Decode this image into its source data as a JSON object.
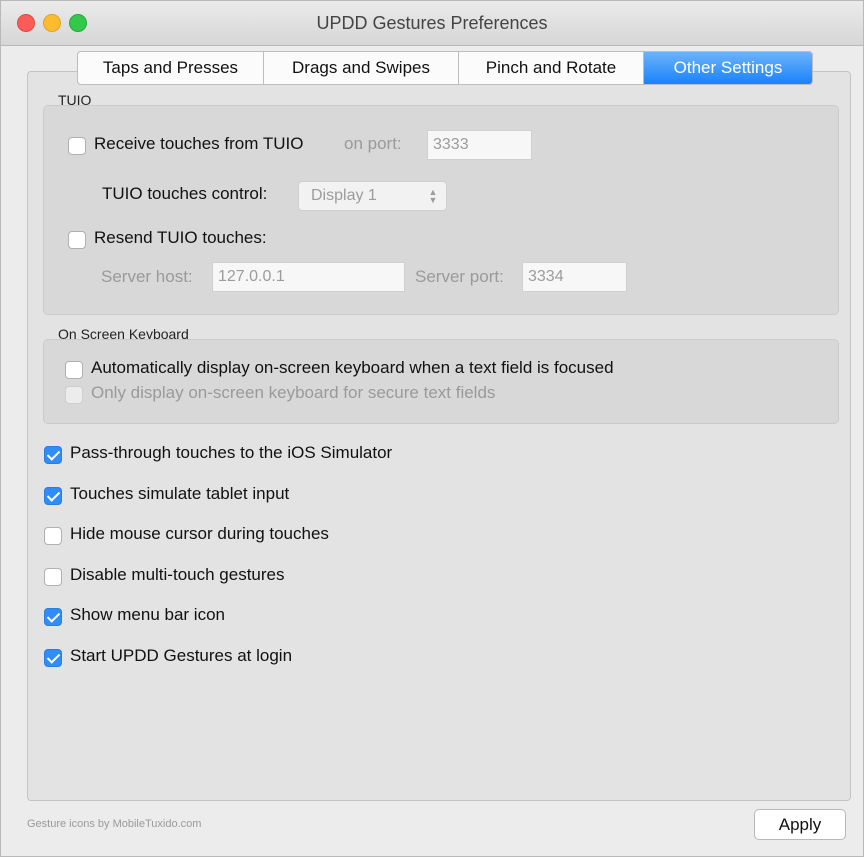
{
  "window": {
    "title": "UPDD Gestures Preferences"
  },
  "tabs": [
    {
      "label": "Taps and Presses",
      "active": false
    },
    {
      "label": "Drags and Swipes",
      "active": false
    },
    {
      "label": "Pinch and Rotate",
      "active": false
    },
    {
      "label": "Other Settings",
      "active": true
    }
  ],
  "tuio": {
    "section_label": "TUIO",
    "receive_label": "Receive touches from TUIO",
    "receive_checked": false,
    "port_label": "on port:",
    "port_value": "3333",
    "control_label": "TUIO touches control:",
    "control_value": "Display 1",
    "resend_label": "Resend TUIO touches:",
    "resend_checked": false,
    "server_host_label": "Server host:",
    "server_host_value": "127.0.0.1",
    "server_port_label": "Server port:",
    "server_port_value": "3334"
  },
  "keyboard": {
    "section_label": "On Screen Keyboard",
    "auto_label": "Automatically display on-screen keyboard when a text field is focused",
    "auto_checked": false,
    "secure_label": "Only display on-screen keyboard for secure text fields",
    "secure_checked": false,
    "secure_enabled": false
  },
  "options": [
    {
      "label": "Pass-through touches to the iOS Simulator",
      "checked": true
    },
    {
      "label": "Touches simulate tablet input",
      "checked": true
    },
    {
      "label": "Hide mouse cursor during touches",
      "checked": false
    },
    {
      "label": "Disable multi-touch gestures",
      "checked": false
    },
    {
      "label": "Show menu bar icon",
      "checked": true
    },
    {
      "label": "Start UPDD Gestures at login",
      "checked": true
    }
  ],
  "footer": {
    "credit": "Gesture icons by MobileTuxido.com",
    "apply_label": "Apply"
  },
  "colors": {
    "accent": "#2f8cf9",
    "close": "#fc5b57",
    "minimize": "#fdbc2e",
    "maximize": "#34c84a"
  }
}
